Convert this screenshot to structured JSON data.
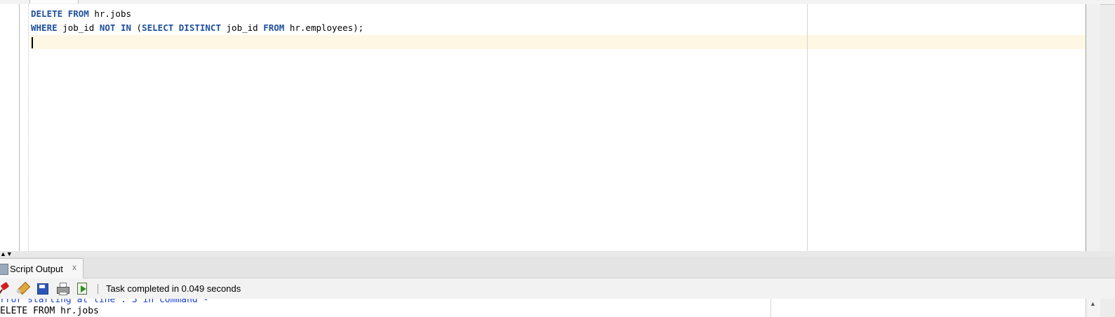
{
  "editor": {
    "lines": [
      [
        {
          "t": "DELETE",
          "kw": true
        },
        {
          "t": " ",
          "kw": false
        },
        {
          "t": "FROM",
          "kw": true
        },
        {
          "t": " hr.jobs",
          "kw": false
        }
      ],
      [
        {
          "t": "WHERE",
          "kw": true
        },
        {
          "t": " job_id ",
          "kw": false
        },
        {
          "t": "NOT",
          "kw": true
        },
        {
          "t": " ",
          "kw": false
        },
        {
          "t": "IN",
          "kw": true
        },
        {
          "t": " (",
          "kw": false
        },
        {
          "t": "SELECT",
          "kw": true
        },
        {
          "t": " ",
          "kw": false
        },
        {
          "t": "DISTINCT",
          "kw": true
        },
        {
          "t": " job_id ",
          "kw": false
        },
        {
          "t": "FROM",
          "kw": true
        },
        {
          "t": " hr.employees);",
          "kw": false
        }
      ]
    ]
  },
  "output_panel": {
    "tab_label": "Script Output",
    "close_glyph": "x",
    "status": "Task completed in 0.049 seconds",
    "lines": [
      "rror starting at line : 3 in command -",
      "ELETE FROM hr.jobs"
    ]
  },
  "toolbar": {
    "icons": [
      "pin-icon",
      "eraser-icon",
      "save-icon",
      "print-icon",
      "open-icon"
    ]
  },
  "colors": {
    "keyword": "#1f4f9c",
    "current_line": "#fdf7e3",
    "error_text": "#1b3fd1"
  }
}
